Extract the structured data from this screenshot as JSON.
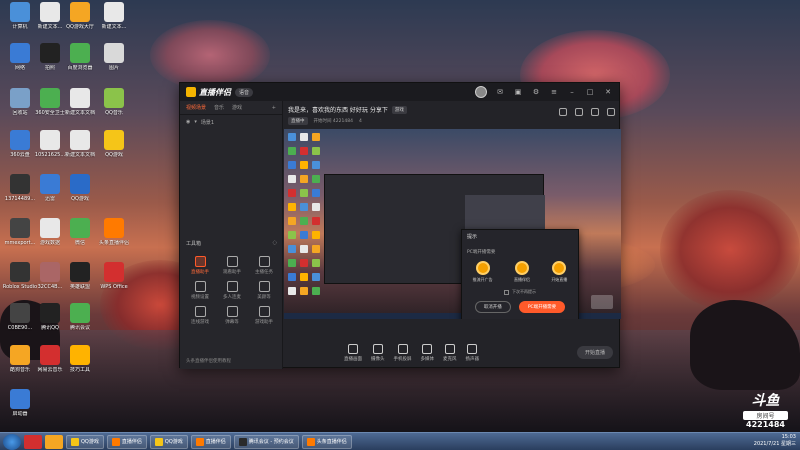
{
  "desktop": {
    "icons": [
      {
        "label": "计算机",
        "color": "#4a90d9"
      },
      {
        "label": "新建文本...",
        "color": "#e8e8e8"
      },
      {
        "label": "QQ游戏大厅",
        "color": "#f5a623"
      },
      {
        "label": "新建文本...",
        "color": "#e8e8e8"
      },
      {
        "label": "网络",
        "color": "#3a7bd5"
      },
      {
        "label": "拍照",
        "color": "#222222"
      },
      {
        "label": "百度浏览器",
        "color": "#4caf50"
      },
      {
        "label": "图片",
        "color": "#d9d9d9"
      },
      {
        "label": "回收站",
        "color": "#7aa0c8"
      },
      {
        "label": "360安全卫士",
        "color": "#4caf50"
      },
      {
        "label": "新建文本文档",
        "color": "#e8e8e8"
      },
      {
        "label": "QQ音乐",
        "color": "#8bc34a"
      },
      {
        "label": "360云盘",
        "color": "#3a7bd5"
      },
      {
        "label": "10521625...",
        "color": "#e8e8e8"
      },
      {
        "label": "新建文本文档",
        "color": "#e8e8e8"
      },
      {
        "label": "QQ游戏",
        "color": "#f5c518"
      },
      {
        "label": "13714489...",
        "color": "#333333"
      },
      {
        "label": "迅雷",
        "color": "#3a7bd5"
      },
      {
        "label": "QQ游戏",
        "color": "#2a6bc8"
      },
      {
        "label": "mmexport...",
        "color": "#444444"
      },
      {
        "label": "游戏数据",
        "color": "#e8e8e8"
      },
      {
        "label": "微信",
        "color": "#4caf50"
      },
      {
        "label": "头条直播伴侣",
        "color": "#ff7a00"
      },
      {
        "label": "Roblox Studio",
        "color": "#333333"
      },
      {
        "label": "32CC4B...",
        "color": "#aa6666"
      },
      {
        "label": "英雄联盟",
        "color": "#222222"
      },
      {
        "label": "WPS Office",
        "color": "#d32f2f"
      },
      {
        "label": "C0BE90...",
        "color": "#444444"
      },
      {
        "label": "腾讯QQ",
        "color": "#222222"
      },
      {
        "label": "腾讯会议",
        "color": "#4caf50"
      },
      {
        "label": "酷狗音乐",
        "color": "#f5a623"
      },
      {
        "label": "网易云音乐",
        "color": "#d32f2f"
      },
      {
        "label": "技巧工具",
        "color": "#ffb300"
      },
      {
        "label": "启动器",
        "color": "#3a7bd5"
      }
    ]
  },
  "app": {
    "title": "直播伴侣",
    "version_badge": "语音",
    "left_tabs": [
      "视频场景",
      "音乐",
      "游戏"
    ],
    "scene_name": "场景1",
    "tools_header": "工具箱",
    "tools": [
      {
        "label": "直播助手",
        "hot": true
      },
      {
        "label": "观看助手",
        "hot": false
      },
      {
        "label": "主播任务",
        "hot": false
      },
      {
        "label": "视频设置",
        "hot": false
      },
      {
        "label": "多人连麦",
        "hot": false
      },
      {
        "label": "美颜等",
        "hot": false
      },
      {
        "label": "连线游戏",
        "hot": false
      },
      {
        "label": "弹幕等",
        "hot": false
      },
      {
        "label": "游戏助手",
        "hot": false
      }
    ],
    "left_footer": "头条直播伴侣使用教程",
    "stream_title": "我是来，喜欢我的东西 好好玩 分享下",
    "stream_tag": "游戏",
    "stream_meta": [
      "直播中",
      "开始时间 4221484",
      "4"
    ],
    "dialog": {
      "title": "提示",
      "subtitle": "PC端开播需要",
      "options": [
        "推流开广告",
        "直播伴侣",
        "开始直播"
      ],
      "checkbox": "下次不再提示",
      "cancel": "取消开播",
      "confirm": "PC端开播需要"
    },
    "bottom_tools": [
      "直播画面",
      "摄像头",
      "手机投屏",
      "多媒体",
      "麦克风",
      "扬声器"
    ],
    "start_live": "开始直播"
  },
  "watermark": {
    "logo": "斗鱼",
    "room_label": "房间号",
    "room_number": "4221484"
  },
  "taskbar": {
    "tasks": [
      "QQ游戏",
      "直播伴侣",
      "QQ游戏",
      "直播伴侣",
      "腾讯会议 - 预约会议",
      "头条直播伴侣"
    ],
    "time": "15:03",
    "date": "2021/7/21 星期三"
  }
}
